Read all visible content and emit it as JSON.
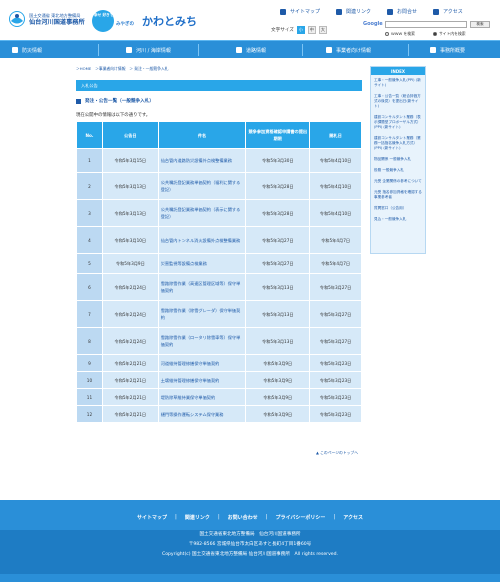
{
  "header": {
    "org_line1": "国土交通省 東北地方整備局",
    "org_line2": "仙台河川国道事務所",
    "brand_small": "幸せ 好きです",
    "brand_miyagi": "みやぎの",
    "brand_main": "かわとみち",
    "top_links": [
      "サイトマップ",
      "関連リンク",
      "お問合せ",
      "アクセス"
    ],
    "font_size_label": "文字サイズ",
    "font_sizes": [
      "小",
      "中",
      "大"
    ],
    "search_logo": "Google",
    "search_button": "検索",
    "search_opt1": "WWW を検索",
    "search_opt2": "サイト内を検索"
  },
  "nav": [
    "防災情報",
    "河川 / 海岸情報",
    "道路情報",
    "事業者向け情報",
    "事務所概要"
  ],
  "breadcrumb": "＞HOME　＞事業者向け情報　＞ 発注・一般競争入札",
  "section_title": "入札公告",
  "heading": "発注・公告一覧（一般競争入札）",
  "note": "現在公開中の情報は以下の通りです。",
  "table": {
    "headers": [
      "No.",
      "公告日",
      "件名",
      "競争参加資格確認申請書の提出期限",
      "開札日"
    ],
    "rows": [
      [
        "1",
        "令和5年3月15日",
        "仙台管内道路防災設備外点検整備業務",
        "令和5年3月30日",
        "令和5年4月10日"
      ],
      [
        "2",
        "令和5年3月13日",
        "公共嘱託登記業務単価契約（福利に関する登記）",
        "令和5年3月28日",
        "令和5年4月10日"
      ],
      [
        "3",
        "令和5年3月13日",
        "公共嘱託登記業務単価契約（表示に関する登記）",
        "令和5年3月28日",
        "令和5年4月10日"
      ],
      [
        "4",
        "令和5年3月10日",
        "仙台管内トンネル消火設備外点検整備業務",
        "令和5年3月27日",
        "令和5年4月7日"
      ],
      [
        "5",
        "令和5年3月9日",
        "災害監視等設備点検業務",
        "令和5年3月27日",
        "令和5年4月7日"
      ],
      [
        "6",
        "令和5年2月24日",
        "雪路除雪作業（高速区管理区域等）保守単価契約",
        "令和5年3月13日",
        "令和5年3月27日"
      ],
      [
        "7",
        "令和5年2月24日",
        "雪路除雪作業（除雪グレーダ）保守単価契約",
        "令和5年3月13日",
        "令和5年3月27日"
      ],
      [
        "8",
        "令和5年2月24日",
        "雪路除雪作業（ロータリ除雪車等）保守単価契約",
        "令和5年3月13日",
        "令和5年3月27日"
      ],
      [
        "9",
        "令和5年2月21日",
        "河道維持管理修繕保守単価契約",
        "令和5年3月9日",
        "令和5年3月23日"
      ],
      [
        "10",
        "令和5年2月21日",
        "土壌維持管理修繕保守単価契約",
        "令和5年3月9日",
        "令和5年3月23日"
      ],
      [
        "11",
        "令和5年2月21日",
        "堤防除草維持業保守単価契約",
        "令和5年3月9日",
        "令和5年3月23日"
      ],
      [
        "12",
        "令和5年2月21日",
        "樋門等操作運転システム保守業務",
        "令和5年3月9日",
        "令和5年3月23日"
      ]
    ]
  },
  "pagetop": "▲ このページのトップへ",
  "sidebar": {
    "title": "INDEX",
    "items": [
      "工事・一般競争入札(PPI) (新サイト)",
      "工事・公告一覧（総合評価方式の後見）を提出日(新サイト)",
      "建設コンサルタント業務（表示課題型プロポーザル方式）(PPI) (新サイト)",
      "建設コンサルタント業務（業務一括指名競争入札方式）(PPI) (新サイト)",
      "物品関係 一般競争入札",
      "役務 一般競争入札",
      "元受 企業関係の参考について",
      "元受 指名参加資格を確認する事業参考者",
      "質問窓口（公告用）",
      "見込・一般競争入札"
    ]
  },
  "footer": {
    "links": [
      "サイトマップ",
      "関連リンク",
      "お問い合わせ",
      "プライバシーポリシー",
      "アクセス"
    ],
    "addr1": "国土交通省東北地方整備局　仙台河川国道事務所",
    "addr2": "〒982-8566 宮城県仙台市太白区あすと長町4丁目1番60号",
    "copyright": "Copyright(c) 国土交通省東北地方整備局 仙台河川国道事務所　All rights reserved."
  },
  "colors": {
    "primary": "#2a8fd8",
    "accent": "#29a6e8",
    "cell": "#d6e9f8",
    "link": "#1e5aa8"
  }
}
